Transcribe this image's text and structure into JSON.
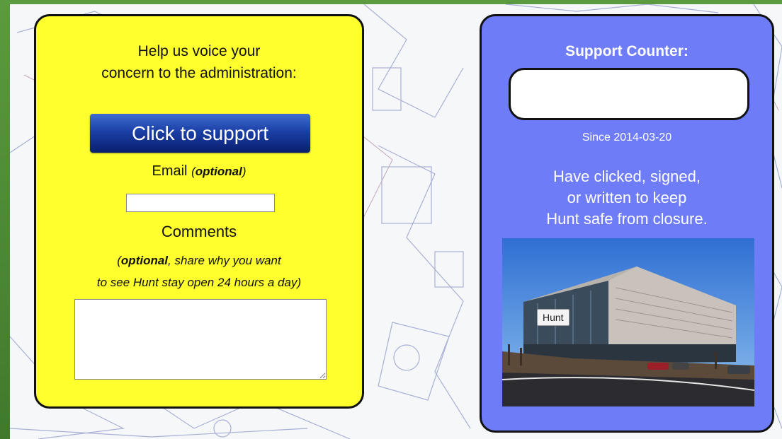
{
  "support_form": {
    "headline_line1": "Help us voice your",
    "headline_line2": "concern to the administration:",
    "support_button_label": "Click to support",
    "email_label": "Email",
    "email_optional": "optional",
    "email_value": "",
    "comments_label": "Comments",
    "comments_hint_optional": "optional",
    "comments_hint_rest": ", share why you want",
    "comments_hint_line2": "to see Hunt stay open 24 hours a day)",
    "comments_value": ""
  },
  "counter_panel": {
    "title": "Support Counter:",
    "count_value": "",
    "since_text": "Since 2014-03-20",
    "statement_line1": "Have clicked, signed,",
    "statement_line2": "or written to keep",
    "statement_line3": "Hunt safe from closure.",
    "photo_tooltip": "Hunt"
  },
  "colors": {
    "left_panel": "#ffff2e",
    "right_panel": "#6f7cf8",
    "button": "#1b3fa6",
    "page_edge": "#4f8a3a"
  }
}
